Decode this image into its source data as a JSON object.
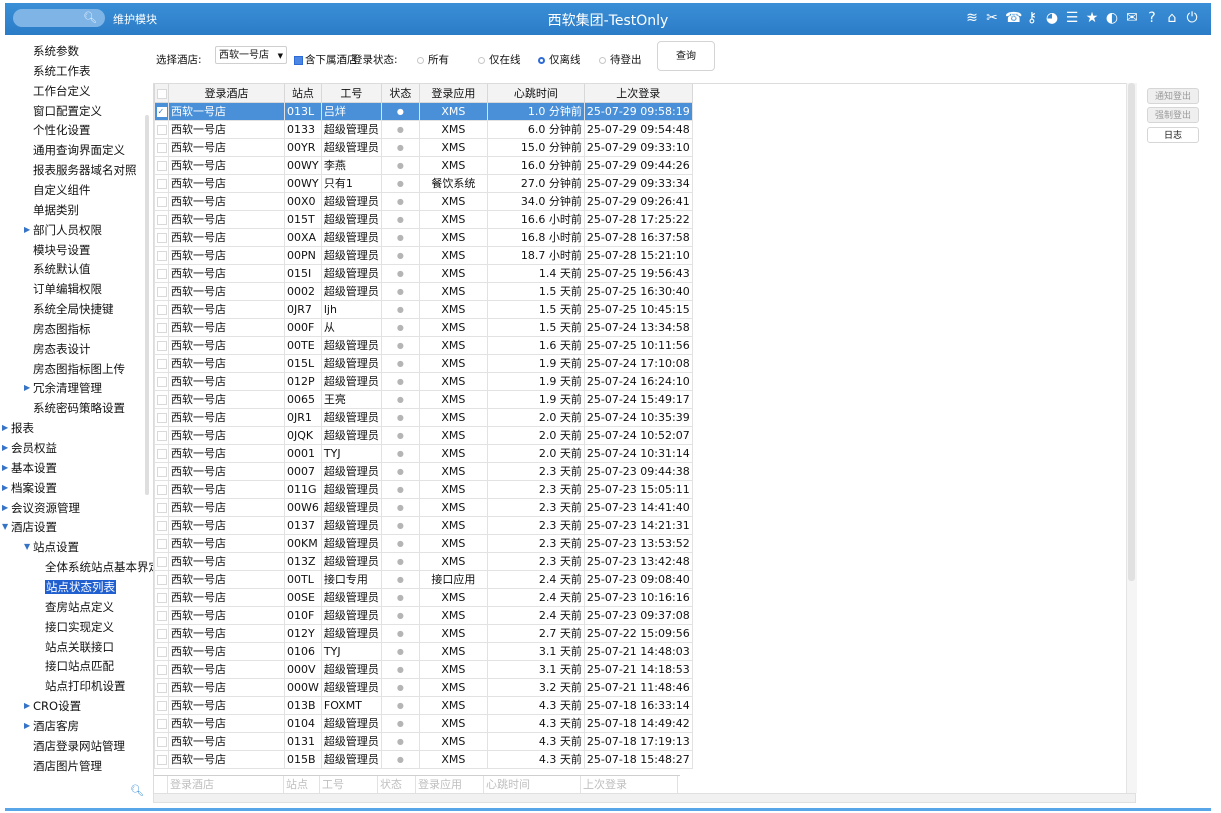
{
  "header": {
    "search_icon": "search-icon",
    "module_label": "维护模块",
    "title": "西软集团-TestOnly",
    "icons": [
      "wifi-icon",
      "tools-icon",
      "phone-icon",
      "key-icon",
      "palette-icon",
      "menu-icon",
      "star-icon",
      "contrast-icon",
      "mail-icon",
      "help-icon",
      "home-icon",
      "power-icon"
    ],
    "icon_glyphs": [
      "≋",
      "✂",
      "☎",
      "⚷",
      "◕",
      "☰",
      "★",
      "◐",
      "✉",
      "?",
      "⌂",
      "⏻"
    ]
  },
  "sidebar": {
    "items": [
      {
        "label": "系统参数",
        "level": 2
      },
      {
        "label": "系统工作表",
        "level": 2
      },
      {
        "label": "工作台定义",
        "level": 2
      },
      {
        "label": "窗口配置定义",
        "level": 2
      },
      {
        "label": "个性化设置",
        "level": 2
      },
      {
        "label": "通用查询界面定义",
        "level": 2
      },
      {
        "label": "报表服务器域名对照",
        "level": 2
      },
      {
        "label": "自定义组件",
        "level": 2
      },
      {
        "label": "单据类别",
        "level": 2
      },
      {
        "label": "部门人员权限",
        "level": 2,
        "arrow": "right"
      },
      {
        "label": "模块号设置",
        "level": 2
      },
      {
        "label": "系统默认值",
        "level": 2
      },
      {
        "label": "订单编辑权限",
        "level": 2
      },
      {
        "label": "系统全局快捷键",
        "level": 2
      },
      {
        "label": "房态图指标",
        "level": 2
      },
      {
        "label": "房态表设计",
        "level": 2
      },
      {
        "label": "房态图指标图上传",
        "level": 2
      },
      {
        "label": "冗余清理管理",
        "level": 2,
        "arrow": "right"
      },
      {
        "label": "系统密码策略设置",
        "level": 2
      },
      {
        "label": "报表",
        "level": 1,
        "arrow": "right"
      },
      {
        "label": "会员权益",
        "level": 1,
        "arrow": "right"
      },
      {
        "label": "基本设置",
        "level": 1,
        "arrow": "right"
      },
      {
        "label": "档案设置",
        "level": 1,
        "arrow": "right"
      },
      {
        "label": "会议资源管理",
        "level": 1,
        "arrow": "right"
      },
      {
        "label": "酒店设置",
        "level": 1,
        "arrow": "down"
      },
      {
        "label": "站点设置",
        "level": 2,
        "arrow": "down"
      },
      {
        "label": "全体系统站点基本界定",
        "level": 3
      },
      {
        "label": "站点状态列表",
        "level": 3,
        "selected": true
      },
      {
        "label": "查房站点定义",
        "level": 3
      },
      {
        "label": "接口实现定义",
        "level": 3
      },
      {
        "label": "站点关联接口",
        "level": 3
      },
      {
        "label": "接口站点匹配",
        "level": 3
      },
      {
        "label": "站点打印机设置",
        "level": 3
      },
      {
        "label": "CRO设置",
        "level": 2,
        "arrow": "right"
      },
      {
        "label": "酒店客房",
        "level": 2,
        "arrow": "right"
      },
      {
        "label": "酒店登录网站管理",
        "level": 2
      },
      {
        "label": "酒店图片管理",
        "level": 2
      }
    ],
    "search_icon": "search-icon"
  },
  "filter": {
    "hotel_label": "选择酒店:",
    "hotel_value": "西软一号店",
    "include_sub_label": "含下属酒店",
    "status_label": "登录状态:",
    "radios": [
      {
        "label": "所有",
        "checked": false
      },
      {
        "label": "仅在线",
        "checked": false
      },
      {
        "label": "仅离线",
        "checked": true
      },
      {
        "label": "待登出",
        "checked": false
      }
    ],
    "query_label": "查询"
  },
  "table": {
    "columns": [
      "登录酒店",
      "站点",
      "工号",
      "状态",
      "登录应用",
      "心跳时间",
      "上次登录"
    ],
    "rows": [
      [
        "西软一号店",
        "013L",
        "吕烊",
        "●",
        "XMS",
        "1.0 分钟前",
        "25-07-29 09:58:19"
      ],
      [
        "西软一号店",
        "0133",
        "超级管理员",
        "●",
        "XMS",
        "6.0 分钟前",
        "25-07-29 09:54:48"
      ],
      [
        "西软一号店",
        "00YR",
        "超级管理员",
        "●",
        "XMS",
        "15.0 分钟前",
        "25-07-29 09:33:10"
      ],
      [
        "西软一号店",
        "00WY",
        "李燕",
        "●",
        "XMS",
        "16.0 分钟前",
        "25-07-29 09:44:26"
      ],
      [
        "西软一号店",
        "00WY",
        "只有1",
        "●",
        "餐饮系统",
        "27.0 分钟前",
        "25-07-29 09:33:34"
      ],
      [
        "西软一号店",
        "00X0",
        "超级管理员",
        "●",
        "XMS",
        "34.0 分钟前",
        "25-07-29 09:26:41"
      ],
      [
        "西软一号店",
        "015T",
        "超级管理员",
        "●",
        "XMS",
        "16.6 小时前",
        "25-07-28 17:25:22"
      ],
      [
        "西软一号店",
        "00XA",
        "超级管理员",
        "●",
        "XMS",
        "16.8 小时前",
        "25-07-28 16:37:58"
      ],
      [
        "西软一号店",
        "00PN",
        "超级管理员",
        "●",
        "XMS",
        "18.7 小时前",
        "25-07-28 15:21:10"
      ],
      [
        "西软一号店",
        "015I",
        "超级管理员",
        "●",
        "XMS",
        "1.4 天前",
        "25-07-25 19:56:43"
      ],
      [
        "西软一号店",
        "0002",
        "超级管理员",
        "●",
        "XMS",
        "1.5 天前",
        "25-07-25 16:30:40"
      ],
      [
        "西软一号店",
        "0JR7",
        "ljh",
        "●",
        "XMS",
        "1.5 天前",
        "25-07-25 10:45:15"
      ],
      [
        "西软一号店",
        "000F",
        "从",
        "●",
        "XMS",
        "1.5 天前",
        "25-07-24 13:34:58"
      ],
      [
        "西软一号店",
        "00TE",
        "超级管理员",
        "●",
        "XMS",
        "1.6 天前",
        "25-07-25 10:11:56"
      ],
      [
        "西软一号店",
        "015L",
        "超级管理员",
        "●",
        "XMS",
        "1.9 天前",
        "25-07-24 17:10:08"
      ],
      [
        "西软一号店",
        "012P",
        "超级管理员",
        "●",
        "XMS",
        "1.9 天前",
        "25-07-24 16:24:10"
      ],
      [
        "西软一号店",
        "0065",
        "王亮",
        "●",
        "XMS",
        "1.9 天前",
        "25-07-24 15:49:17"
      ],
      [
        "西软一号店",
        "0JR1",
        "超级管理员",
        "●",
        "XMS",
        "2.0 天前",
        "25-07-24 10:35:39"
      ],
      [
        "西软一号店",
        "0JQK",
        "超级管理员",
        "●",
        "XMS",
        "2.0 天前",
        "25-07-24 10:52:07"
      ],
      [
        "西软一号店",
        "0001",
        "TYJ",
        "●",
        "XMS",
        "2.0 天前",
        "25-07-24 10:31:14"
      ],
      [
        "西软一号店",
        "0007",
        "超级管理员",
        "●",
        "XMS",
        "2.3 天前",
        "25-07-23 09:44:38"
      ],
      [
        "西软一号店",
        "011G",
        "超级管理员",
        "●",
        "XMS",
        "2.3 天前",
        "25-07-23 15:05:11"
      ],
      [
        "西软一号店",
        "00W6",
        "超级管理员",
        "●",
        "XMS",
        "2.3 天前",
        "25-07-23 14:41:40"
      ],
      [
        "西软一号店",
        "0137",
        "超级管理员",
        "●",
        "XMS",
        "2.3 天前",
        "25-07-23 14:21:31"
      ],
      [
        "西软一号店",
        "00KM",
        "超级管理员",
        "●",
        "XMS",
        "2.3 天前",
        "25-07-23 13:53:52"
      ],
      [
        "西软一号店",
        "013Z",
        "超级管理员",
        "●",
        "XMS",
        "2.3 天前",
        "25-07-23 13:42:48"
      ],
      [
        "西软一号店",
        "00TL",
        "接口专用",
        "●",
        "接口应用",
        "2.4 天前",
        "25-07-23 09:08:40"
      ],
      [
        "西软一号店",
        "00SE",
        "超级管理员",
        "●",
        "XMS",
        "2.4 天前",
        "25-07-23 10:16:16"
      ],
      [
        "西软一号店",
        "010F",
        "超级管理员",
        "●",
        "XMS",
        "2.4 天前",
        "25-07-23 09:37:08"
      ],
      [
        "西软一号店",
        "012Y",
        "超级管理员",
        "●",
        "XMS",
        "2.7 天前",
        "25-07-22 15:09:56"
      ],
      [
        "西软一号店",
        "0106",
        "TYJ",
        "●",
        "XMS",
        "3.1 天前",
        "25-07-21 14:48:03"
      ],
      [
        "西软一号店",
        "000V",
        "超级管理员",
        "●",
        "XMS",
        "3.1 天前",
        "25-07-21 14:18:53"
      ],
      [
        "西软一号店",
        "000W",
        "超级管理员",
        "●",
        "XMS",
        "3.2 天前",
        "25-07-21 11:48:46"
      ],
      [
        "西软一号店",
        "013B",
        "FOXMT",
        "●",
        "XMS",
        "4.3 天前",
        "25-07-18 16:33:14"
      ],
      [
        "西软一号店",
        "0104",
        "超级管理员",
        "●",
        "XMS",
        "4.3 天前",
        "25-07-18 14:49:42"
      ],
      [
        "西软一号店",
        "0131",
        "超级管理员",
        "●",
        "XMS",
        "4.3 天前",
        "25-07-18 17:19:13"
      ],
      [
        "西软一号店",
        "015B",
        "超级管理员",
        "●",
        "XMS",
        "4.3 天前",
        "25-07-18 15:48:27"
      ]
    ],
    "selected_row": 0,
    "footer": [
      "登录酒店",
      "站点",
      "工号",
      "状态",
      "登录应用",
      "心跳时间",
      "上次登录"
    ]
  },
  "actions": {
    "notify_logout": "通知登出",
    "force_logout": "强制登出",
    "log": "日志"
  },
  "colors": {
    "header_blue": "#2b7cc7",
    "selection_blue": "#4a90d9",
    "nav_selected": "#1f5fd0"
  }
}
